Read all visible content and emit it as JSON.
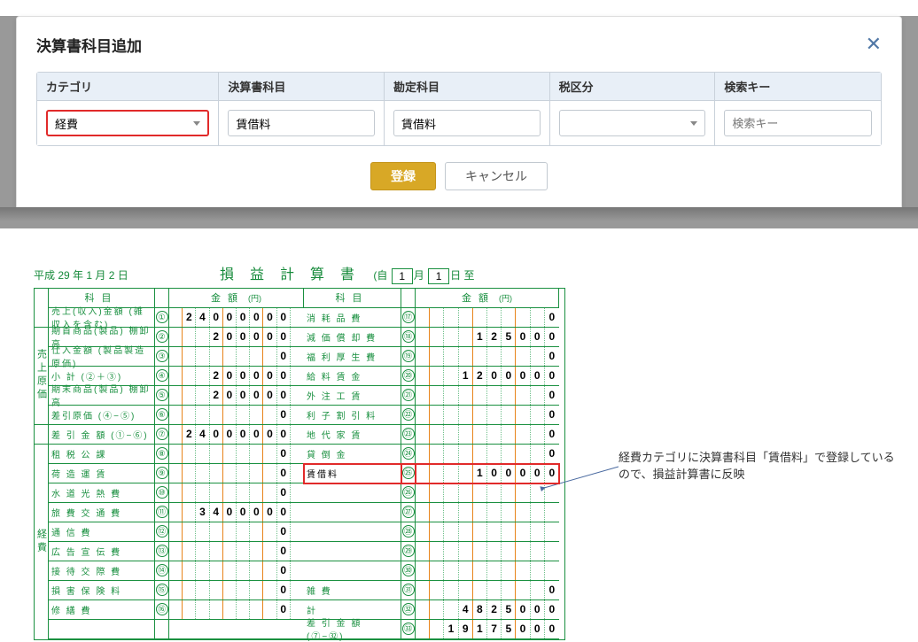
{
  "modal": {
    "title": "決算書科目追加",
    "headers": {
      "category": "カテゴリ",
      "fs_item": "決算書科目",
      "account": "勘定科目",
      "tax": "税区分",
      "search": "検索キー"
    },
    "values": {
      "category": "経費",
      "fs_item": "賃借料",
      "account": "賃借料",
      "tax": "",
      "search_ph": "検索キー"
    },
    "buttons": {
      "submit": "登録",
      "cancel": "キャンセル"
    }
  },
  "pl": {
    "date_prefix": "平成 29 年 1 月 2 日",
    "title": "損益計算書",
    "period_prefix": "(自",
    "period_m": "1",
    "period_d": "1",
    "period_mid": "月",
    "period_d_lbl": "日 至",
    "side_left1": "売上原価",
    "side_left2": "経費",
    "head_kamoku": "科目",
    "head_kingaku": "金額",
    "unit": "(円)",
    "rows_left1": [
      {
        "n": "①",
        "label": "売上(収入)金額 (雑収入を含む)",
        "digits": [
          "",
          "2",
          "4",
          "0",
          "0",
          "0",
          "0",
          "0",
          "0",
          ""
        ]
      },
      {
        "n": "②",
        "label": "期首商品(製品) 棚卸高",
        "digits": [
          "",
          "",
          "",
          "2",
          "0",
          "0",
          "0",
          "0",
          "0",
          ""
        ]
      },
      {
        "n": "③",
        "label": "仕入金額 (製品製造 原価)",
        "digits": [
          "",
          "",
          "",
          "",
          "",
          "",
          "",
          "",
          "0",
          ""
        ]
      },
      {
        "n": "④",
        "label": "小 計 (②＋③)",
        "digits": [
          "",
          "",
          "",
          "2",
          "0",
          "0",
          "0",
          "0",
          "0",
          ""
        ]
      },
      {
        "n": "⑤",
        "label": "期末商品(製品) 棚卸高",
        "digits": [
          "",
          "",
          "",
          "2",
          "0",
          "0",
          "0",
          "0",
          "0",
          ""
        ]
      },
      {
        "n": "⑥",
        "label": "差引原価 (④−⑤)",
        "digits": [
          "",
          "",
          "",
          "",
          "",
          "",
          "",
          "",
          "0",
          ""
        ]
      }
    ],
    "row_diff1": {
      "n": "⑦",
      "label": "差 引 金 額 (①−⑥)",
      "digits": [
        "",
        "2",
        "4",
        "0",
        "0",
        "0",
        "0",
        "0",
        "0",
        ""
      ]
    },
    "rows_left2": [
      {
        "n": "⑧",
        "label": "租 税 公 課",
        "digits": [
          "",
          "",
          "",
          "",
          "",
          "",
          "",
          "",
          "0",
          ""
        ]
      },
      {
        "n": "⑨",
        "label": "荷 造 運 賃",
        "digits": [
          "",
          "",
          "",
          "",
          "",
          "",
          "",
          "",
          "0",
          ""
        ]
      },
      {
        "n": "⑩",
        "label": "水 道 光 熱 費",
        "digits": [
          "",
          "",
          "",
          "",
          "",
          "",
          "",
          "",
          "0",
          ""
        ]
      },
      {
        "n": "⑪",
        "label": "旅 費 交 通 費",
        "digits": [
          "",
          "",
          "3",
          "4",
          "0",
          "0",
          "0",
          "0",
          "0",
          ""
        ]
      },
      {
        "n": "⑫",
        "label": "通 信 費",
        "digits": [
          "",
          "",
          "",
          "",
          "",
          "",
          "",
          "",
          "0",
          ""
        ]
      },
      {
        "n": "⑬",
        "label": "広 告 宣 伝 費",
        "digits": [
          "",
          "",
          "",
          "",
          "",
          "",
          "",
          "",
          "0",
          ""
        ]
      },
      {
        "n": "⑭",
        "label": "接 待 交 際 費",
        "digits": [
          "",
          "",
          "",
          "",
          "",
          "",
          "",
          "",
          "0",
          ""
        ]
      },
      {
        "n": "⑮",
        "label": "損 害 保 険 料",
        "digits": [
          "",
          "",
          "",
          "",
          "",
          "",
          "",
          "",
          "0",
          ""
        ]
      },
      {
        "n": "⑯",
        "label": "修 繕 費",
        "digits": [
          "",
          "",
          "",
          "",
          "",
          "",
          "",
          "",
          "0",
          ""
        ]
      }
    ],
    "rows_right": [
      {
        "n": "⑰",
        "label": "消 耗 品 費",
        "digits": [
          "",
          "",
          "",
          "",
          "",
          "",
          "",
          "",
          "",
          "0"
        ]
      },
      {
        "n": "⑱",
        "label": "減 価 償 却 費",
        "digits": [
          "",
          "",
          "",
          "",
          "1",
          "2",
          "5",
          "0",
          "0",
          "0"
        ]
      },
      {
        "n": "⑲",
        "label": "福 利 厚 生 費",
        "digits": [
          "",
          "",
          "",
          "",
          "",
          "",
          "",
          "",
          "",
          "0"
        ]
      },
      {
        "n": "⑳",
        "label": "給 料 賃 金",
        "digits": [
          "",
          "",
          "",
          "1",
          "2",
          "0",
          "0",
          "0",
          "0",
          "0"
        ]
      },
      {
        "n": "㉑",
        "label": "外 注 工 賃",
        "digits": [
          "",
          "",
          "",
          "",
          "",
          "",
          "",
          "",
          "",
          "0"
        ]
      },
      {
        "n": "㉒",
        "label": "利 子 割 引 料",
        "digits": [
          "",
          "",
          "",
          "",
          "",
          "",
          "",
          "",
          "",
          "0"
        ]
      },
      {
        "n": "㉓",
        "label": "地 代 家 賃",
        "digits": [
          "",
          "",
          "",
          "",
          "",
          "",
          "",
          "",
          "",
          "0"
        ]
      },
      {
        "n": "㉔",
        "label": "貸 倒 金",
        "digits": [
          "",
          "",
          "",
          "",
          "",
          "",
          "",
          "",
          "",
          "0"
        ]
      },
      {
        "n": "㉕",
        "label": "賃借料",
        "digits": [
          "",
          "",
          "",
          "",
          "1",
          "0",
          "0",
          "0",
          "0",
          "0"
        ],
        "hl": true,
        "black": true
      },
      {
        "n": "㉖",
        "label": "",
        "digits": [
          "",
          "",
          "",
          "",
          "",
          "",
          "",
          "",
          "",
          ""
        ]
      },
      {
        "n": "㉗",
        "label": "",
        "digits": [
          "",
          "",
          "",
          "",
          "",
          "",
          "",
          "",
          "",
          ""
        ]
      },
      {
        "n": "㉘",
        "label": "",
        "digits": [
          "",
          "",
          "",
          "",
          "",
          "",
          "",
          "",
          "",
          ""
        ]
      },
      {
        "n": "㉙",
        "label": "",
        "digits": [
          "",
          "",
          "",
          "",
          "",
          "",
          "",
          "",
          "",
          ""
        ]
      },
      {
        "n": "㉚",
        "label": "",
        "digits": [
          "",
          "",
          "",
          "",
          "",
          "",
          "",
          "",
          "",
          ""
        ]
      },
      {
        "n": "㉛",
        "label": "雑 費",
        "digits": [
          "",
          "",
          "",
          "",
          "",
          "",
          "",
          "",
          "",
          "0"
        ]
      },
      {
        "n": "㉜",
        "label": "計",
        "digits": [
          "",
          "",
          "",
          "4",
          "8",
          "2",
          "5",
          "0",
          "0",
          "0"
        ]
      },
      {
        "n": "㉝",
        "label": "差 引 金 額 (⑦−㉜)",
        "digits": [
          "",
          "",
          "1",
          "9",
          "1",
          "7",
          "5",
          "0",
          "0",
          "0"
        ]
      }
    ]
  },
  "annotation": "経費カテゴリに決算書科目「賃借料」で登録しているので、損益計算書に反映"
}
